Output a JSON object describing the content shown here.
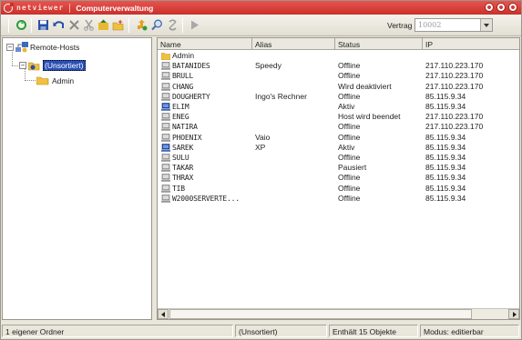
{
  "app": {
    "brand": "netviewer",
    "title": "Computerverwaltung"
  },
  "toolbar": {
    "vertrag_label": "Vertrag",
    "vertrag_value": "10002",
    "icons": [
      "refresh-icon",
      "save-icon",
      "undo-icon",
      "delete-icon",
      "cut-icon",
      "move-icon",
      "new-folder-icon",
      "connect-icon",
      "search-icon",
      "disconnect-icon",
      "play-icon"
    ]
  },
  "tree": {
    "root": "Remote-Hosts",
    "selected": "(Unsortiert)",
    "child": "Admin"
  },
  "list": {
    "columns": [
      "Name",
      "Alias",
      "Status",
      "IP"
    ],
    "rows": [
      {
        "type": "folder",
        "name": "Admin",
        "alias": "",
        "status": "",
        "ip": ""
      },
      {
        "type": "computer",
        "name": "BATANIDES",
        "alias": "Speedy",
        "status": "Offline",
        "ip": "217.110.223.170"
      },
      {
        "type": "computer",
        "name": "BRULL",
        "alias": "",
        "status": "Offline",
        "ip": "217.110.223.170"
      },
      {
        "type": "computer",
        "name": "CHANG",
        "alias": "",
        "status": "Wird deaktiviert",
        "ip": "217.110.223.170"
      },
      {
        "type": "computer",
        "name": "DOUGHERTY",
        "alias": "Ingo's Rechner",
        "status": "Offline",
        "ip": "85.115.9.34"
      },
      {
        "type": "active",
        "name": "ELIM",
        "alias": "",
        "status": "Aktiv",
        "ip": "85.115.9.34"
      },
      {
        "type": "computer",
        "name": "ENEG",
        "alias": "",
        "status": "Host wird beendet",
        "ip": "217.110.223.170"
      },
      {
        "type": "computer",
        "name": "NATIRA",
        "alias": "",
        "status": "Offline",
        "ip": "217.110.223.170"
      },
      {
        "type": "computer",
        "name": "PHOENIX",
        "alias": "Vaio",
        "status": "Offline",
        "ip": "85.115.9.34"
      },
      {
        "type": "active",
        "name": "SAREK",
        "alias": "XP",
        "status": "Aktiv",
        "ip": "85.115.9.34"
      },
      {
        "type": "computer",
        "name": "SULU",
        "alias": "",
        "status": "Offline",
        "ip": "85.115.9.34"
      },
      {
        "type": "computer",
        "name": "TAKAR",
        "alias": "",
        "status": "Pausiert",
        "ip": "85.115.9.34"
      },
      {
        "type": "computer",
        "name": "THRAX",
        "alias": "",
        "status": "Offline",
        "ip": "85.115.9.34"
      },
      {
        "type": "computer",
        "name": "TIB",
        "alias": "",
        "status": "Offline",
        "ip": "85.115.9.34"
      },
      {
        "type": "computer",
        "name": "W2000SERVERTE...",
        "alias": "",
        "status": "Offline",
        "ip": "85.115.9.34"
      }
    ]
  },
  "status": {
    "folders": "1 eigener Ordner",
    "location": "(Unsortiert)",
    "count": "Enthält 15 Objekte",
    "mode": "Modus: editierbar"
  }
}
